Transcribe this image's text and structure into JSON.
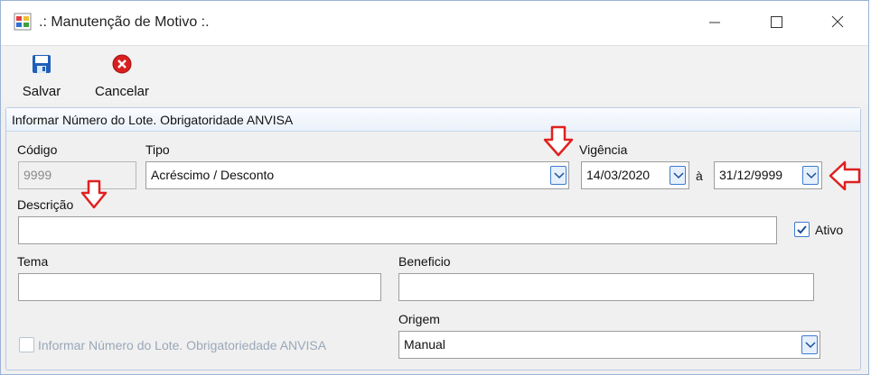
{
  "window": {
    "title": ".: Manutenção de Motivo :."
  },
  "toolbar": {
    "save_label": "Salvar",
    "cancel_label": "Cancelar"
  },
  "group": {
    "title": "Informar Número do Lote. Obrigatoridade ANVISA"
  },
  "form": {
    "codigo_label": "Código",
    "codigo_value": "9999",
    "tipo_label": "Tipo",
    "tipo_value": "Acréscimo / Desconto",
    "vigencia_label": "Vigência",
    "vigencia_from": "14/03/2020",
    "vigencia_sep": "à",
    "vigencia_to": "31/12/9999",
    "descricao_label": "Descrição",
    "descricao_value": "",
    "ativo_label": "Ativo",
    "ativo_checked": true,
    "tema_label": "Tema",
    "tema_value": "",
    "beneficio_label": "Beneficio",
    "beneficio_value": "",
    "origem_label": "Origem",
    "origem_value": "Manual",
    "lote_checkbox_label": "Informar Número do Lote. Obrigatoriedade ANVISA",
    "lote_checked": false
  },
  "colors": {
    "accent": "#3e7ad1",
    "annotation_arrow": "#e02020"
  }
}
